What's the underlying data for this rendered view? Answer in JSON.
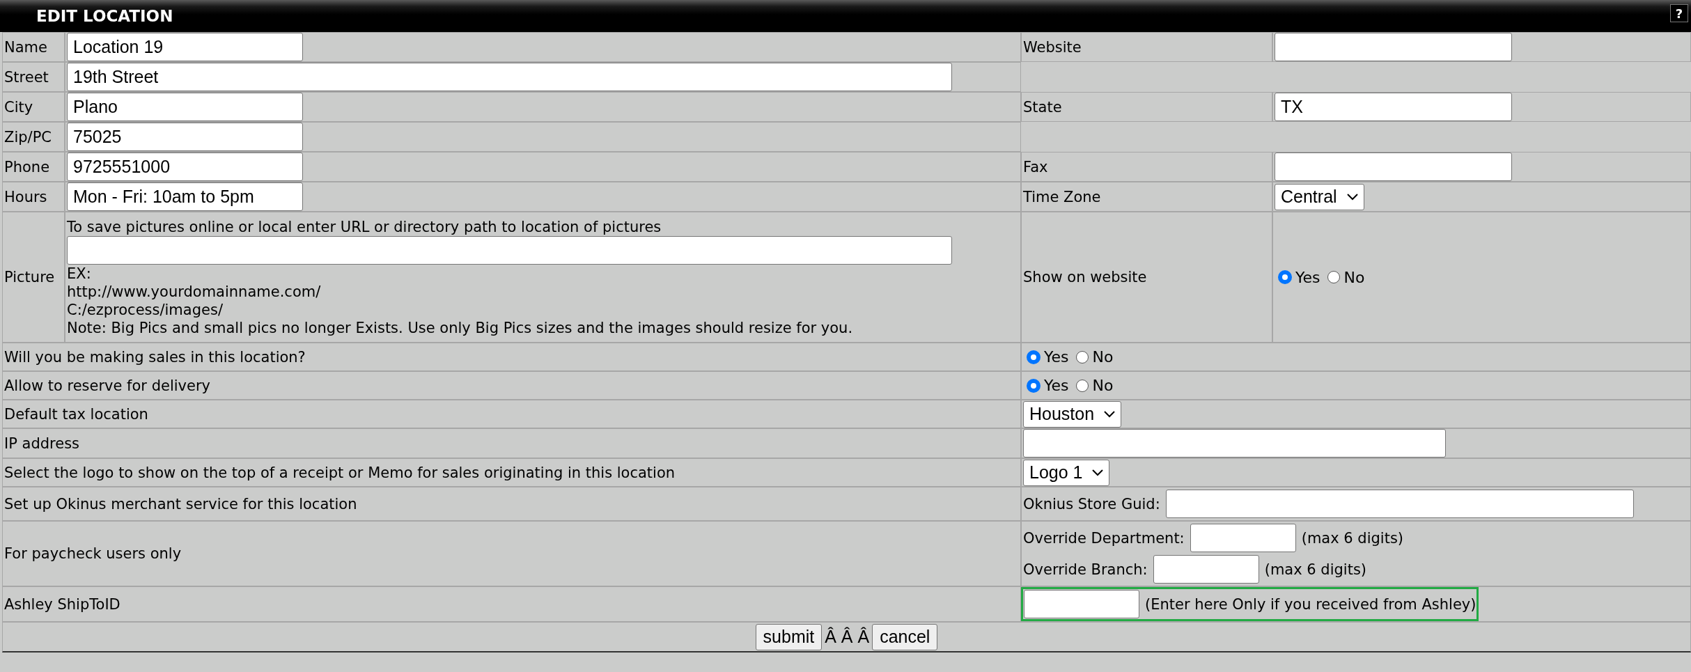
{
  "header": {
    "title": "EDIT LOCATION",
    "help": "?"
  },
  "top_rows": [
    {
      "label": "Name",
      "kind": "short",
      "value": "Location 19",
      "right": {
        "label": "Website",
        "kind": "input"
      }
    },
    {
      "label": "Street",
      "kind": "long",
      "value": "19th Street"
    },
    {
      "label": "City",
      "kind": "short",
      "value": "Plano",
      "right": {
        "label": "State",
        "kind": "input",
        "value": "TX"
      }
    },
    {
      "label": "Zip/PC",
      "kind": "short",
      "value": "75025"
    },
    {
      "label": "Phone",
      "kind": "short",
      "value": "9725551000",
      "right": {
        "label": "Fax",
        "kind": "input"
      }
    },
    {
      "label": "Hours",
      "kind": "short",
      "value": "Mon - Fri: 10am to 5pm",
      "right": {
        "label": "Time Zone",
        "kind": "select",
        "value": "Central"
      }
    },
    {
      "label": "Picture",
      "kind": "picture",
      "hint": "To save pictures online or local enter URL or directory path to location of pictures",
      "notes": [
        "EX:",
        "http://www.yourdomainname.com/",
        "C:/ezprocess/images/",
        "Note: Big Pics and small pics no longer Exists. Use only Big Pics sizes and the images should resize for you."
      ],
      "right": {
        "label": "Show on website",
        "kind": "radio",
        "options": [
          {
            "label": "Yes",
            "selected": true
          },
          {
            "label": "No",
            "selected": false
          }
        ]
      }
    }
  ],
  "rows": [
    {
      "label": "Will you be making sales in this location?",
      "kind": "radio",
      "options": [
        {
          "label": "Yes",
          "selected": true
        },
        {
          "label": "No",
          "selected": false
        }
      ]
    },
    {
      "label": "Allow to reserve for delivery",
      "kind": "radio",
      "options": [
        {
          "label": "Yes",
          "selected": true
        },
        {
          "label": "No",
          "selected": false
        }
      ]
    },
    {
      "label": "Default tax location",
      "kind": "select",
      "value": "Houston"
    },
    {
      "label": "IP address",
      "kind": "input"
    },
    {
      "label": "Select the logo to show on the top of a receipt or Memo for sales originating in this location",
      "kind": "select",
      "value": "Logo 1"
    },
    {
      "label": "Set up Okinus merchant service for this location",
      "kind": "labeled",
      "fields": [
        {
          "label": "Oknius Store Guid:"
        }
      ]
    },
    {
      "label": "For paycheck users only",
      "kind": "labeled",
      "fields": [
        {
          "label": "Override Department:",
          "note": "(max 6 digits)"
        },
        {
          "label": "Override Branch:",
          "note": "(max 6 digits)"
        }
      ]
    },
    {
      "label": "Ashley ShipToID",
      "kind": "highlighted",
      "note": "(Enter here Only if you received from Ashley)"
    }
  ],
  "buttons": {
    "submit": "submit",
    "separator": "Â Â Â",
    "cancel": "cancel"
  }
}
